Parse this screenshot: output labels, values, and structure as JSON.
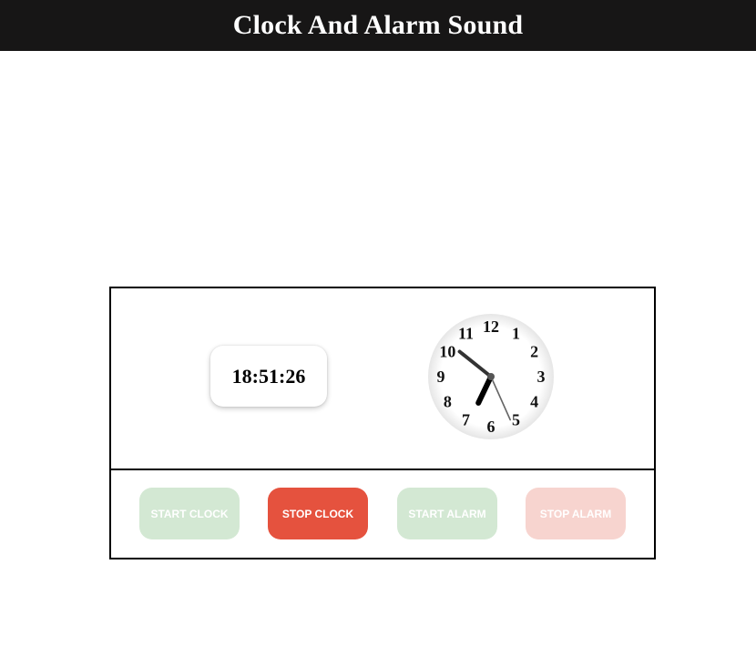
{
  "header": {
    "title": "Clock And Alarm Sound"
  },
  "digital_clock": {
    "time": "18:51:26"
  },
  "analog_clock": {
    "numerals": [
      "12",
      "1",
      "2",
      "3",
      "4",
      "5",
      "6",
      "7",
      "8",
      "9",
      "10",
      "11"
    ],
    "hours": 18,
    "minutes": 51,
    "seconds": 26
  },
  "buttons": {
    "start_clock": "START CLOCK",
    "stop_clock": "STOP CLOCK",
    "start_alarm": "START ALARM",
    "stop_alarm": "STOP ALARM"
  },
  "colors": {
    "header_bg": "#171616",
    "start_disabled": "#d3e8d3",
    "stop_active": "#e5523e",
    "stop_disabled": "#f7d4cf"
  }
}
